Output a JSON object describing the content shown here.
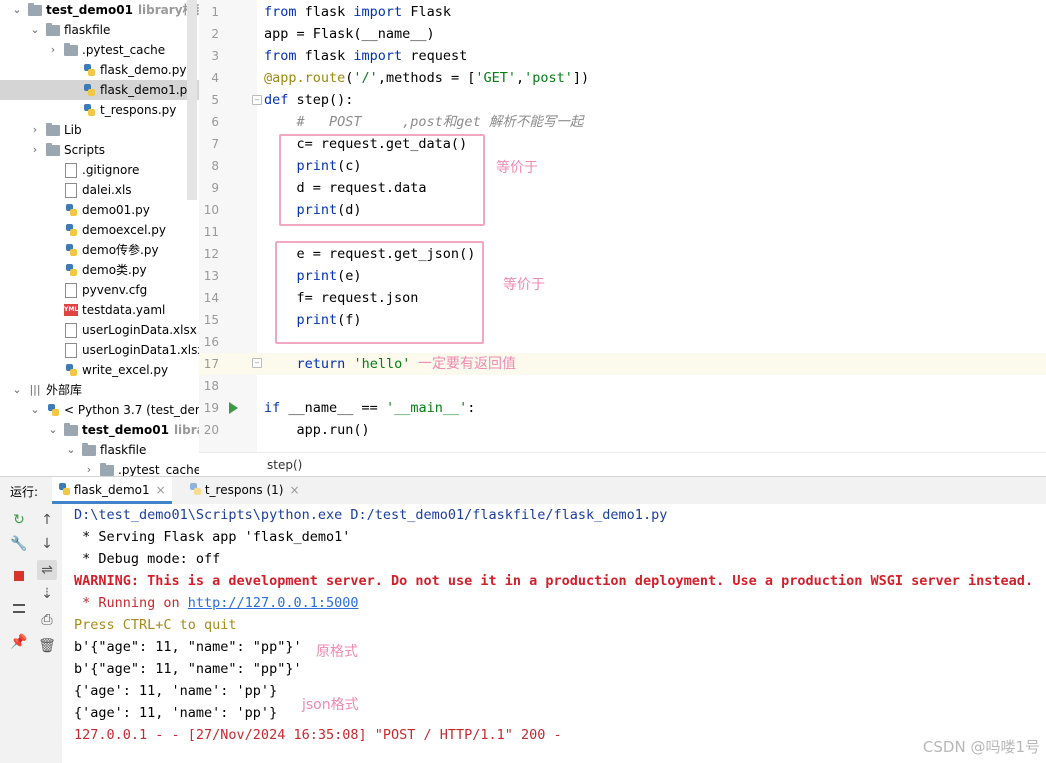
{
  "tree": {
    "rows": [
      {
        "label": "test_demo01",
        "hint": "library根目录",
        "icon": "folder-icon",
        "chev": "v",
        "indent": 0,
        "bold": true
      },
      {
        "label": "flaskfile",
        "icon": "folder-icon",
        "chev": "v",
        "indent": 1
      },
      {
        "label": ".pytest_cache",
        "icon": "folder-icon",
        "chev": ">",
        "indent": 2
      },
      {
        "label": "flask_demo.py",
        "icon": "python-file-icon",
        "indent": 3
      },
      {
        "label": "flask_demo1.py",
        "icon": "python-file-icon",
        "indent": 3,
        "selected": true
      },
      {
        "label": "t_respons.py",
        "icon": "python-file-icon",
        "indent": 3
      },
      {
        "label": "Lib",
        "icon": "folder-icon",
        "chev": ">",
        "indent": 1
      },
      {
        "label": "Scripts",
        "icon": "folder-icon",
        "chev": ">",
        "indent": 1
      },
      {
        "label": ".gitignore",
        "icon": "file-icon",
        "indent": 2
      },
      {
        "label": "dalei.xls",
        "icon": "file-icon",
        "indent": 2
      },
      {
        "label": "demo01.py",
        "icon": "python-file-icon",
        "indent": 2
      },
      {
        "label": "demoexcel.py",
        "icon": "python-file-icon",
        "indent": 2
      },
      {
        "label": "demo传参.py",
        "icon": "python-file-icon",
        "indent": 2
      },
      {
        "label": "demo类.py",
        "icon": "python-file-icon",
        "indent": 2
      },
      {
        "label": "pyvenv.cfg",
        "icon": "file-icon",
        "indent": 2
      },
      {
        "label": "testdata.yaml",
        "icon": "yaml-file-icon",
        "indent": 2
      },
      {
        "label": "userLoginData.xlsx",
        "icon": "file-icon",
        "indent": 2
      },
      {
        "label": "userLoginData1.xlsx",
        "icon": "file-icon",
        "indent": 2
      },
      {
        "label": "write_excel.py",
        "icon": "python-file-icon",
        "indent": 2
      },
      {
        "label": "外部库",
        "icon": "library-icon",
        "chev": "v",
        "indent": 0
      },
      {
        "label": "< Python 3.7 (test_dem",
        "icon": "python-file-icon",
        "chev": "v",
        "indent": 1
      },
      {
        "label": "test_demo01",
        "hint": "librar",
        "icon": "folder-icon",
        "chev": "v",
        "indent": 2,
        "bold": true
      },
      {
        "label": "flaskfile",
        "icon": "folder-icon",
        "chev": "v",
        "indent": 3
      },
      {
        "label": ".pytest_cache",
        "icon": "folder-icon",
        "chev": ">",
        "indent": 4
      }
    ]
  },
  "editor": {
    "line_numbers": [
      "1",
      "2",
      "3",
      "4",
      "5",
      "6",
      "7",
      "8",
      "9",
      "10",
      "11",
      "12",
      "13",
      "14",
      "15",
      "16",
      "17",
      "18",
      "19",
      "20"
    ],
    "lines": [
      [
        {
          "t": "from",
          "c": "kw"
        },
        {
          "t": " flask ",
          "c": ""
        },
        {
          "t": "import",
          "c": "kw"
        },
        {
          "t": " Flask",
          "c": ""
        }
      ],
      [
        {
          "t": "app = Flask(__name__)",
          "c": ""
        }
      ],
      [
        {
          "t": "from",
          "c": "kw"
        },
        {
          "t": " flask ",
          "c": ""
        },
        {
          "t": "import",
          "c": "kw"
        },
        {
          "t": " request",
          "c": ""
        }
      ],
      [
        {
          "t": "@app.route",
          "c": "dec"
        },
        {
          "t": "(",
          "c": ""
        },
        {
          "t": "'/'",
          "c": "st"
        },
        {
          "t": ",methods = [",
          "c": ""
        },
        {
          "t": "'GET'",
          "c": "st"
        },
        {
          "t": ",",
          "c": ""
        },
        {
          "t": "'post'",
          "c": "st"
        },
        {
          "t": "])",
          "c": ""
        }
      ],
      [
        {
          "t": "def",
          "c": "kw"
        },
        {
          "t": " step():",
          "c": ""
        }
      ],
      [
        {
          "t": "    #   POST     ,post和get 解析不能写一起",
          "c": "cm"
        }
      ],
      [
        {
          "t": "    c= request.get_data()",
          "c": ""
        }
      ],
      [
        {
          "t": "    ",
          "c": ""
        },
        {
          "t": "print",
          "c": "kw"
        },
        {
          "t": "(c)",
          "c": ""
        }
      ],
      [
        {
          "t": "    d = request.data",
          "c": ""
        }
      ],
      [
        {
          "t": "    ",
          "c": ""
        },
        {
          "t": "print",
          "c": "kw"
        },
        {
          "t": "(d)",
          "c": ""
        }
      ],
      [
        {
          "t": "",
          "c": ""
        }
      ],
      [
        {
          "t": "    e = request.get_json()",
          "c": ""
        }
      ],
      [
        {
          "t": "    ",
          "c": ""
        },
        {
          "t": "print",
          "c": "kw"
        },
        {
          "t": "(e)",
          "c": ""
        }
      ],
      [
        {
          "t": "    f= request.json",
          "c": ""
        }
      ],
      [
        {
          "t": "    ",
          "c": ""
        },
        {
          "t": "print",
          "c": "kw"
        },
        {
          "t": "(f)",
          "c": ""
        }
      ],
      [
        {
          "t": "",
          "c": ""
        }
      ],
      [
        {
          "t": "    ",
          "c": ""
        },
        {
          "t": "return",
          "c": "kw"
        },
        {
          "t": " ",
          "c": ""
        },
        {
          "t": "'hello'",
          "c": "st"
        }
      ],
      [
        {
          "t": "",
          "c": ""
        }
      ],
      [
        {
          "t": "if",
          "c": "kw"
        },
        {
          "t": " __name__ == ",
          "c": ""
        },
        {
          "t": "'__main__'",
          "c": "st"
        },
        {
          "t": ":",
          "c": ""
        }
      ],
      [
        {
          "t": "    app.run()",
          "c": ""
        }
      ]
    ],
    "annotations": {
      "box1_note": "等价于",
      "box2_note": "等价于",
      "return_note": "一定要有返回值"
    },
    "breadcrumb": "step()"
  },
  "runbar": {
    "label": "运行:",
    "tabs": [
      {
        "label": "flask_demo1",
        "active": true,
        "close": "×"
      },
      {
        "label": "t_respons (1)",
        "active": false,
        "close": "×"
      }
    ]
  },
  "console": {
    "lines": [
      [
        {
          "t": "D:\\test_demo01\\Scripts\\python.exe D:/test_demo01/flaskfile/flask_demo1.py",
          "c": "path"
        }
      ],
      [
        {
          "t": " * Serving Flask app 'flask_demo1'",
          "c": "plain"
        }
      ],
      [
        {
          "t": " * Debug mode: off",
          "c": "plain"
        }
      ],
      [
        {
          "t": "WARNING: This is a development server. Do not use it in a production deployment. Use a production WSGI server instead.",
          "c": "warn"
        }
      ],
      [
        {
          "t": " * Running on ",
          "c": "redtxt"
        },
        {
          "t": "http://127.0.0.1:5000",
          "c": "link"
        }
      ],
      [
        {
          "t": "Press CTRL+C to quit",
          "c": "yellowish"
        }
      ],
      [
        {
          "t": "b'{\"age\": 11, \"name\": \"pp\"}'",
          "c": "plain"
        }
      ],
      [
        {
          "t": "b'{\"age\": 11, \"name\": \"pp\"}'",
          "c": "plain"
        }
      ],
      [
        {
          "t": "{'age': 11, 'name': 'pp'}",
          "c": "plain"
        }
      ],
      [
        {
          "t": "{'age': 11, 'name': 'pp'}",
          "c": "plain"
        }
      ],
      [
        {
          "t": "127.0.0.1 - - [27/Nov/2024 16:35:08] \"POST / HTTP/1.1\" 200 -",
          "c": "redtxt"
        }
      ]
    ],
    "annotations": {
      "raw_note": "原格式",
      "json_note": "json格式"
    }
  },
  "watermark": "CSDN @吗喽1号",
  "colors": {
    "keyword": "#0033b3",
    "string": "#067d17",
    "annotation_pink": "#f08ab0",
    "warning_red": "#d1202a"
  }
}
